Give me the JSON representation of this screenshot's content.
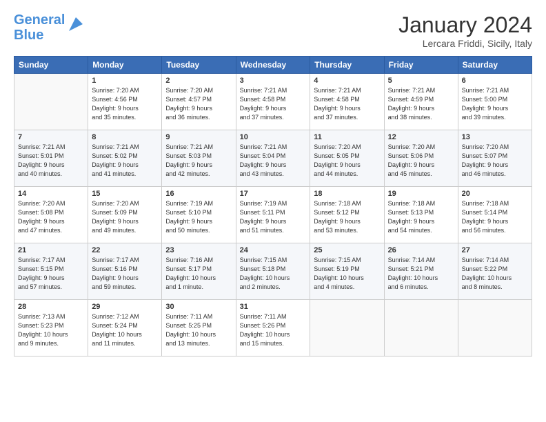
{
  "header": {
    "logo_line1": "General",
    "logo_line2": "Blue",
    "month_title": "January 2024",
    "location": "Lercara Friddi, Sicily, Italy"
  },
  "days_of_week": [
    "Sunday",
    "Monday",
    "Tuesday",
    "Wednesday",
    "Thursday",
    "Friday",
    "Saturday"
  ],
  "weeks": [
    [
      {
        "day": "",
        "info": ""
      },
      {
        "day": "1",
        "info": "Sunrise: 7:20 AM\nSunset: 4:56 PM\nDaylight: 9 hours\nand 35 minutes."
      },
      {
        "day": "2",
        "info": "Sunrise: 7:20 AM\nSunset: 4:57 PM\nDaylight: 9 hours\nand 36 minutes."
      },
      {
        "day": "3",
        "info": "Sunrise: 7:21 AM\nSunset: 4:58 PM\nDaylight: 9 hours\nand 37 minutes."
      },
      {
        "day": "4",
        "info": "Sunrise: 7:21 AM\nSunset: 4:58 PM\nDaylight: 9 hours\nand 37 minutes."
      },
      {
        "day": "5",
        "info": "Sunrise: 7:21 AM\nSunset: 4:59 PM\nDaylight: 9 hours\nand 38 minutes."
      },
      {
        "day": "6",
        "info": "Sunrise: 7:21 AM\nSunset: 5:00 PM\nDaylight: 9 hours\nand 39 minutes."
      }
    ],
    [
      {
        "day": "7",
        "info": "Sunrise: 7:21 AM\nSunset: 5:01 PM\nDaylight: 9 hours\nand 40 minutes."
      },
      {
        "day": "8",
        "info": "Sunrise: 7:21 AM\nSunset: 5:02 PM\nDaylight: 9 hours\nand 41 minutes."
      },
      {
        "day": "9",
        "info": "Sunrise: 7:21 AM\nSunset: 5:03 PM\nDaylight: 9 hours\nand 42 minutes."
      },
      {
        "day": "10",
        "info": "Sunrise: 7:21 AM\nSunset: 5:04 PM\nDaylight: 9 hours\nand 43 minutes."
      },
      {
        "day": "11",
        "info": "Sunrise: 7:20 AM\nSunset: 5:05 PM\nDaylight: 9 hours\nand 44 minutes."
      },
      {
        "day": "12",
        "info": "Sunrise: 7:20 AM\nSunset: 5:06 PM\nDaylight: 9 hours\nand 45 minutes."
      },
      {
        "day": "13",
        "info": "Sunrise: 7:20 AM\nSunset: 5:07 PM\nDaylight: 9 hours\nand 46 minutes."
      }
    ],
    [
      {
        "day": "14",
        "info": "Sunrise: 7:20 AM\nSunset: 5:08 PM\nDaylight: 9 hours\nand 47 minutes."
      },
      {
        "day": "15",
        "info": "Sunrise: 7:20 AM\nSunset: 5:09 PM\nDaylight: 9 hours\nand 49 minutes."
      },
      {
        "day": "16",
        "info": "Sunrise: 7:19 AM\nSunset: 5:10 PM\nDaylight: 9 hours\nand 50 minutes."
      },
      {
        "day": "17",
        "info": "Sunrise: 7:19 AM\nSunset: 5:11 PM\nDaylight: 9 hours\nand 51 minutes."
      },
      {
        "day": "18",
        "info": "Sunrise: 7:18 AM\nSunset: 5:12 PM\nDaylight: 9 hours\nand 53 minutes."
      },
      {
        "day": "19",
        "info": "Sunrise: 7:18 AM\nSunset: 5:13 PM\nDaylight: 9 hours\nand 54 minutes."
      },
      {
        "day": "20",
        "info": "Sunrise: 7:18 AM\nSunset: 5:14 PM\nDaylight: 9 hours\nand 56 minutes."
      }
    ],
    [
      {
        "day": "21",
        "info": "Sunrise: 7:17 AM\nSunset: 5:15 PM\nDaylight: 9 hours\nand 57 minutes."
      },
      {
        "day": "22",
        "info": "Sunrise: 7:17 AM\nSunset: 5:16 PM\nDaylight: 9 hours\nand 59 minutes."
      },
      {
        "day": "23",
        "info": "Sunrise: 7:16 AM\nSunset: 5:17 PM\nDaylight: 10 hours\nand 1 minute."
      },
      {
        "day": "24",
        "info": "Sunrise: 7:15 AM\nSunset: 5:18 PM\nDaylight: 10 hours\nand 2 minutes."
      },
      {
        "day": "25",
        "info": "Sunrise: 7:15 AM\nSunset: 5:19 PM\nDaylight: 10 hours\nand 4 minutes."
      },
      {
        "day": "26",
        "info": "Sunrise: 7:14 AM\nSunset: 5:21 PM\nDaylight: 10 hours\nand 6 minutes."
      },
      {
        "day": "27",
        "info": "Sunrise: 7:14 AM\nSunset: 5:22 PM\nDaylight: 10 hours\nand 8 minutes."
      }
    ],
    [
      {
        "day": "28",
        "info": "Sunrise: 7:13 AM\nSunset: 5:23 PM\nDaylight: 10 hours\nand 9 minutes."
      },
      {
        "day": "29",
        "info": "Sunrise: 7:12 AM\nSunset: 5:24 PM\nDaylight: 10 hours\nand 11 minutes."
      },
      {
        "day": "30",
        "info": "Sunrise: 7:11 AM\nSunset: 5:25 PM\nDaylight: 10 hours\nand 13 minutes."
      },
      {
        "day": "31",
        "info": "Sunrise: 7:11 AM\nSunset: 5:26 PM\nDaylight: 10 hours\nand 15 minutes."
      },
      {
        "day": "",
        "info": ""
      },
      {
        "day": "",
        "info": ""
      },
      {
        "day": "",
        "info": ""
      }
    ]
  ]
}
